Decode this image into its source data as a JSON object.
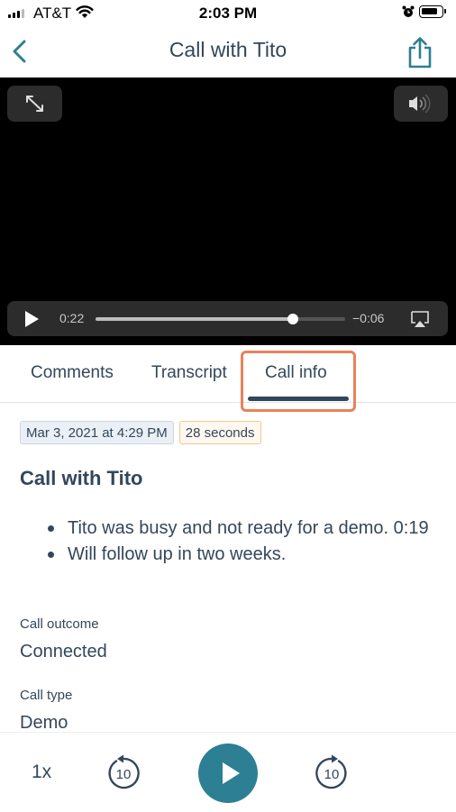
{
  "status_bar": {
    "carrier": "AT&T",
    "time": "2:03 PM"
  },
  "nav": {
    "title": "Call with Tito",
    "back_icon": "chevron-left-icon",
    "share_icon": "share-icon"
  },
  "player": {
    "elapsed": "0:22",
    "remaining": "−0:06",
    "progress": 0.79
  },
  "tabs": [
    {
      "label": "Comments"
    },
    {
      "label": "Transcript"
    },
    {
      "label": "Call info",
      "active": true
    }
  ],
  "call_info": {
    "date": "Mar 3, 2021 at 4:29 PM",
    "duration": "28 seconds",
    "title": "Call with Tito",
    "notes": [
      "Tito was busy and not ready for a demo. 0:19",
      "Will follow up in two weeks."
    ],
    "fields": [
      {
        "label": "Call outcome",
        "value": "Connected"
      },
      {
        "label": "Call type",
        "value": "Demo"
      }
    ]
  },
  "bottom_player": {
    "speed": "1x",
    "rewind_label": "10",
    "forward_label": "10"
  },
  "colors": {
    "accent": "#2d7f94",
    "text": "#33475b",
    "highlight": "#e8825b"
  }
}
